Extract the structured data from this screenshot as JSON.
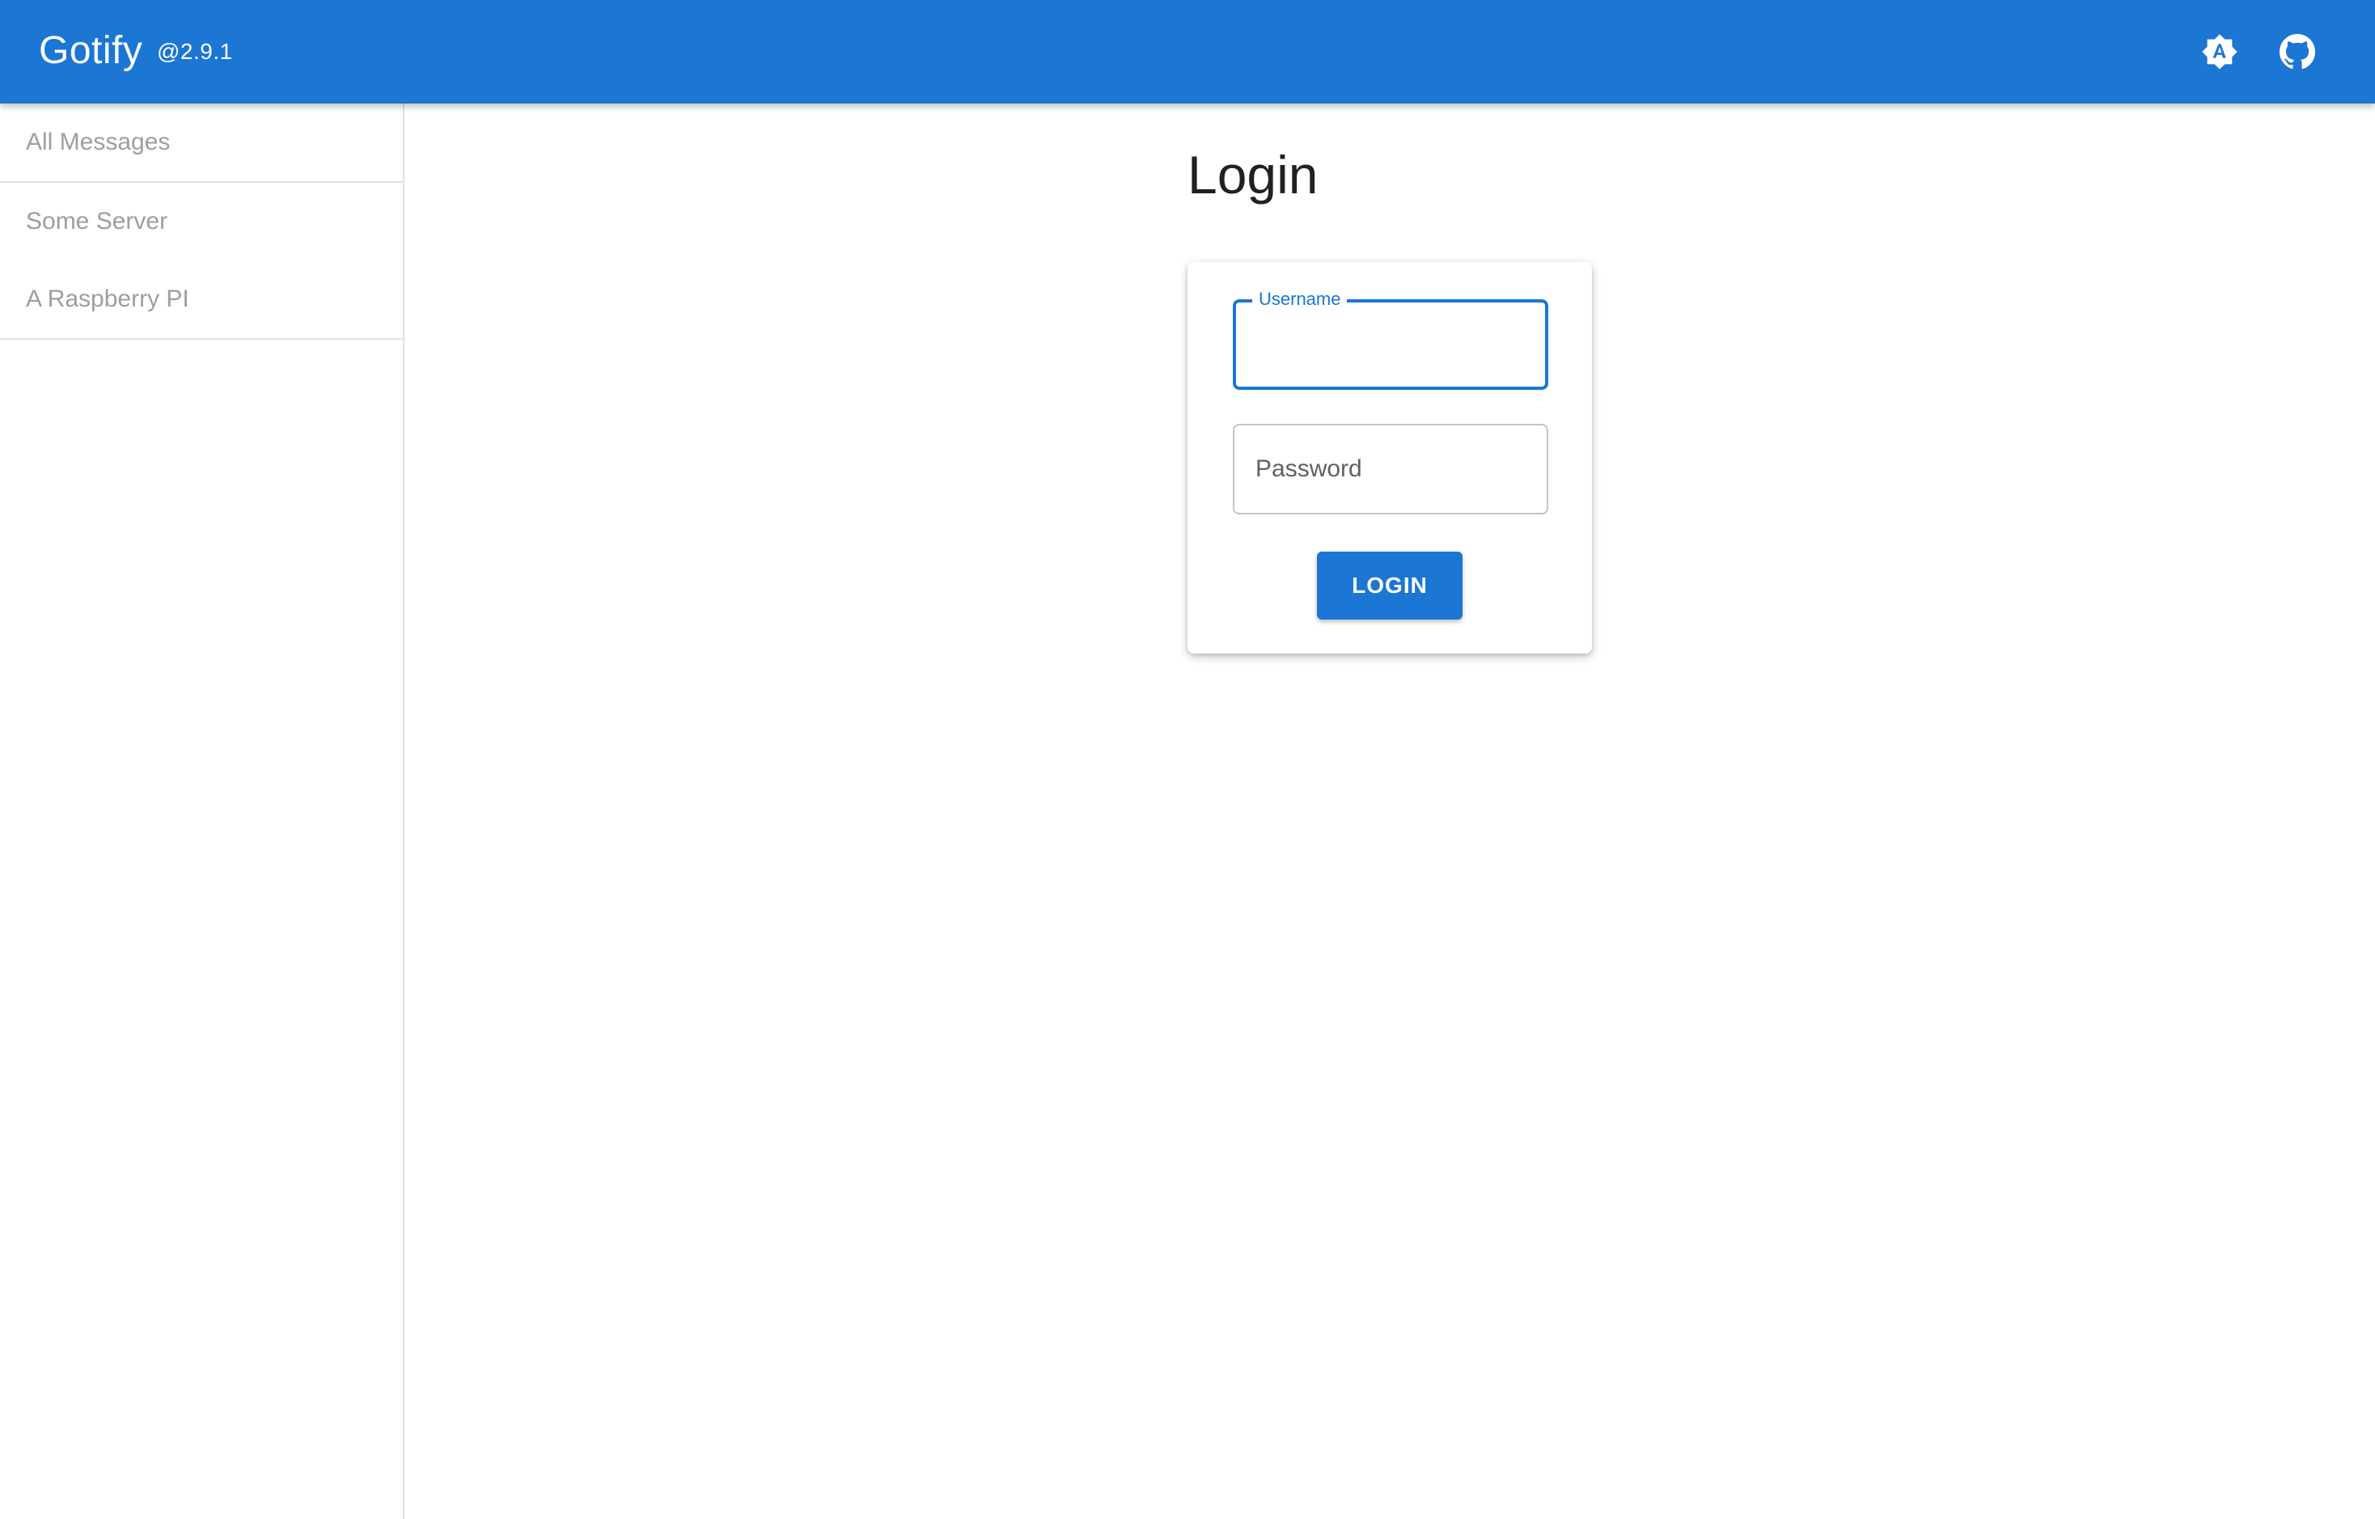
{
  "appbar": {
    "title": "Gotify",
    "version": "@2.9.1",
    "theme_icon": "brightness-auto-icon",
    "github_icon": "github-icon",
    "color": "#1b76d4"
  },
  "sidebar": {
    "items": [
      {
        "label": "All Messages"
      },
      {
        "label": "Some Server"
      },
      {
        "label": "A Raspberry PI"
      }
    ]
  },
  "main": {
    "title": "Login",
    "form": {
      "username": {
        "label": "Username",
        "value": "",
        "placeholder": ""
      },
      "password": {
        "value": "",
        "placeholder": "Password"
      },
      "submit_label": "LOGIN"
    }
  }
}
